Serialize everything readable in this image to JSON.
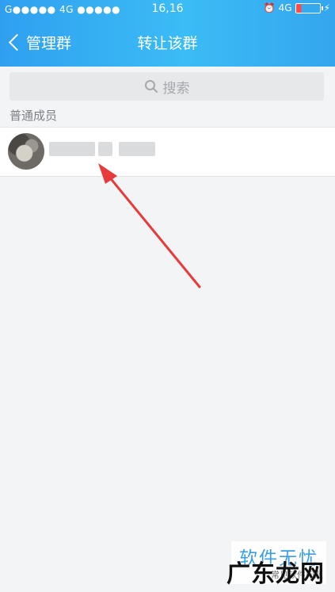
{
  "status_bar": {
    "carrier": "G●●●●● 4G ●●●●●",
    "time": "16,16",
    "network": "4G"
  },
  "header": {
    "back_label": "管理群",
    "title": "转让该群"
  },
  "search": {
    "placeholder": "搜索"
  },
  "section": {
    "title": "普通成员"
  },
  "watermark": {
    "line1": "软件无忧",
    "line2": "常见软件问题",
    "line3": "广东龙网"
  },
  "colors": {
    "header": "#2fa0f0",
    "arrow": "#e83a3a"
  }
}
